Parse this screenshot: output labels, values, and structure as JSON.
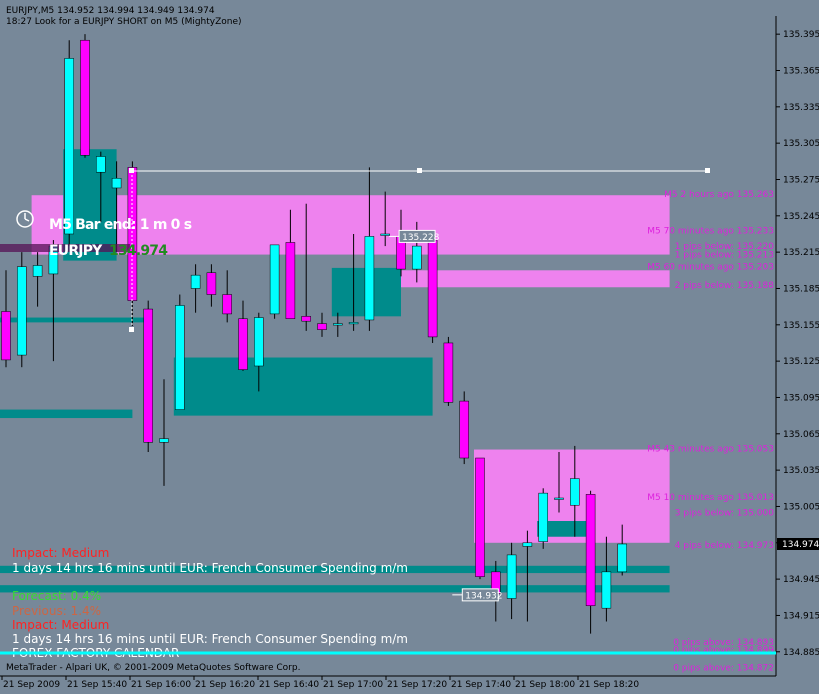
{
  "header": {
    "symbol_line": "EURJPY,M5  134.952 134.994 134.949 134.974",
    "comment_line": "18:27 Look for a EURJPY SHORT on M5 (MightyZone)"
  },
  "overlay": {
    "bar_end": "M5 Bar end: 1 m 0 s",
    "symbol": "EURJPY",
    "price": "134.974"
  },
  "footer": {
    "copyright": "MetaTrader - Alpari UK, © 2001-2009 MetaQuotes Software Corp."
  },
  "news": {
    "impact1": "Impact: Medium",
    "event1": "1 days 14 hrs 16 mins until EUR: French Consumer Spending m/m",
    "forecast": "Forecast: 0.4%",
    "previous": "Previous: 1.4%",
    "impact2": "Impact: Medium",
    "event2": "1 days 14 hrs 16 mins until EUR: French Consumer Spending m/m",
    "calendar": "FOREX FACTORY CALENDAR"
  },
  "colors": {
    "background": "#778899",
    "bull": "#00FFFF",
    "bear": "#FF00FF",
    "zone_teal": "#008B8B",
    "zone_pink": "#EE82EE",
    "zone_label": "#DD22DD"
  },
  "chart_data": {
    "type": "candlestick",
    "ylim": [
      134.865,
      135.41
    ],
    "y_ticks": [
      "135.395",
      "135.365",
      "135.335",
      "135.305",
      "135.275",
      "135.245",
      "135.215",
      "135.185",
      "135.155",
      "135.125",
      "135.095",
      "135.065",
      "135.035",
      "135.005",
      "134.975",
      "134.945",
      "134.915",
      "134.885"
    ],
    "current_price": "134.974",
    "x_labels": [
      "21 Sep 2009",
      "21 Sep 15:40",
      "21 Sep 16:00",
      "21 Sep 16:20",
      "21 Sep 16:40",
      "21 Sep 17:00",
      "21 Sep 17:20",
      "21 Sep 17:40",
      "21 Sep 18:00",
      "21 Sep 18:20"
    ],
    "candles": [
      {
        "o": 135.166,
        "h": 135.2,
        "l": 135.12,
        "c": 135.126
      },
      {
        "o": 135.13,
        "h": 135.215,
        "l": 135.12,
        "c": 135.203
      },
      {
        "o": 135.195,
        "h": 135.215,
        "l": 135.17,
        "c": 135.204
      },
      {
        "o": 135.197,
        "h": 135.225,
        "l": 135.125,
        "c": 135.22
      },
      {
        "o": 135.23,
        "h": 135.39,
        "l": 135.22,
        "c": 135.375
      },
      {
        "o": 135.39,
        "h": 135.395,
        "l": 135.293,
        "c": 135.295
      },
      {
        "o": 135.281,
        "h": 135.298,
        "l": 135.24,
        "c": 135.294
      },
      {
        "o": 135.268,
        "h": 135.29,
        "l": 135.215,
        "c": 135.276
      },
      {
        "o": 135.285,
        "h": 135.29,
        "l": 135.154,
        "c": 135.175
      },
      {
        "o": 135.168,
        "h": 135.175,
        "l": 135.05,
        "c": 135.058
      },
      {
        "o": 135.058,
        "h": 135.11,
        "l": 135.022,
        "c": 135.061
      },
      {
        "o": 135.085,
        "h": 135.18,
        "l": 135.085,
        "c": 135.171
      },
      {
        "o": 135.185,
        "h": 135.205,
        "l": 135.165,
        "c": 135.196
      },
      {
        "o": 135.198,
        "h": 135.205,
        "l": 135.17,
        "c": 135.18
      },
      {
        "o": 135.18,
        "h": 135.2,
        "l": 135.157,
        "c": 135.164
      },
      {
        "o": 135.16,
        "h": 135.175,
        "l": 135.117,
        "c": 135.118
      },
      {
        "o": 135.121,
        "h": 135.165,
        "l": 135.1,
        "c": 135.161
      },
      {
        "o": 135.164,
        "h": 135.218,
        "l": 135.16,
        "c": 135.221
      },
      {
        "o": 135.223,
        "h": 135.25,
        "l": 135.16,
        "c": 135.16
      },
      {
        "o": 135.162,
        "h": 135.255,
        "l": 135.15,
        "c": 135.158
      },
      {
        "o": 135.156,
        "h": 135.165,
        "l": 135.145,
        "c": 135.151
      },
      {
        "o": 135.156,
        "h": 135.165,
        "l": 135.145,
        "c": 135.156
      },
      {
        "o": 135.156,
        "h": 135.23,
        "l": 135.15,
        "c": 135.157
      },
      {
        "o": 135.159,
        "h": 135.285,
        "l": 135.15,
        "c": 135.228
      },
      {
        "o": 135.229,
        "h": 135.265,
        "l": 135.22,
        "c": 135.23
      },
      {
        "o": 135.228,
        "h": 135.25,
        "l": 135.195,
        "c": 135.201
      },
      {
        "o": 135.201,
        "h": 135.24,
        "l": 135.19,
        "c": 135.22
      },
      {
        "o": 135.225,
        "h": 135.23,
        "l": 135.14,
        "c": 135.145
      },
      {
        "o": 135.14,
        "h": 135.145,
        "l": 135.088,
        "c": 135.091
      },
      {
        "o": 135.092,
        "h": 135.1,
        "l": 135.04,
        "c": 135.045
      },
      {
        "o": 135.045,
        "h": 135.045,
        "l": 134.945,
        "c": 134.947
      },
      {
        "o": 134.951,
        "h": 134.96,
        "l": 134.91,
        "c": 134.933
      },
      {
        "o": 134.929,
        "h": 134.975,
        "l": 134.912,
        "c": 134.965
      },
      {
        "o": 134.972,
        "h": 134.985,
        "l": 134.91,
        "c": 134.975
      },
      {
        "o": 134.976,
        "h": 135.02,
        "l": 134.97,
        "c": 135.016
      },
      {
        "o": 135.012,
        "h": 135.05,
        "l": 135.0,
        "c": 135.012
      },
      {
        "o": 135.006,
        "h": 135.055,
        "l": 134.98,
        "c": 135.028
      },
      {
        "o": 135.015,
        "h": 135.018,
        "l": 134.9,
        "c": 134.923
      },
      {
        "o": 134.921,
        "h": 134.98,
        "l": 134.91,
        "c": 134.951
      },
      {
        "o": 134.951,
        "h": 134.99,
        "l": 134.948,
        "c": 134.974
      }
    ],
    "zones": [
      {
        "from_bar": 2,
        "to_bar": 42,
        "top": 135.262,
        "bottom": 135.213,
        "kind": "pink"
      },
      {
        "from_bar": 24,
        "to_bar": 42,
        "top": 135.2,
        "bottom": 135.186,
        "kind": "pink"
      },
      {
        "from_bar": 30,
        "to_bar": 42,
        "top": 135.052,
        "bottom": 134.975,
        "kind": "pink"
      },
      {
        "from_bar": 4,
        "to_bar": 7,
        "top": 135.3,
        "bottom": 135.208,
        "kind": "teal"
      },
      {
        "from_bar": 0,
        "to_bar": 9,
        "top": 135.161,
        "bottom": 135.157,
        "kind": "teal"
      },
      {
        "from_bar": 0,
        "to_bar": 8,
        "top": 135.085,
        "bottom": 135.078,
        "kind": "teal"
      },
      {
        "from_bar": 11,
        "to_bar": 27,
        "top": 135.128,
        "bottom": 135.08,
        "kind": "teal"
      },
      {
        "from_bar": 21,
        "to_bar": 25,
        "top": 135.202,
        "bottom": 135.162,
        "kind": "teal"
      },
      {
        "from_bar": 34,
        "to_bar": 37,
        "top": 134.993,
        "bottom": 134.98,
        "kind": "teal"
      },
      {
        "from_bar": 0,
        "to_bar": 42,
        "top": 134.956,
        "bottom": 134.95,
        "kind": "teal"
      },
      {
        "from_bar": 0,
        "to_bar": 42,
        "top": 134.94,
        "bottom": 134.934,
        "kind": "teal"
      }
    ],
    "zone_labels": [
      {
        "text": "M5 2 hours ago 135.263",
        "y": 135.263
      },
      {
        "text": "M5 70 minutes ago 135.233",
        "y": 135.233
      },
      {
        "text": "1 pips below: 135.220",
        "y": 135.22
      },
      {
        "text": "1 pips below: 135.213",
        "y": 135.213
      },
      {
        "text": "M5 60 minutes ago 135.203",
        "y": 135.203
      },
      {
        "text": "2 pips below: 135.188",
        "y": 135.188
      },
      {
        "text": "M5 43 minutes ago 135.053",
        "y": 135.053
      },
      {
        "text": "M5 10 minutes ago 135.013",
        "y": 135.013
      },
      {
        "text": "3 pips below: 135.000",
        "y": 135.0
      },
      {
        "text": "4 pips below: 134.973",
        "y": 134.973
      },
      {
        "text": "0 pips above: 134.893",
        "y": 134.893
      },
      {
        "text": "0 pips above: 134.899",
        "y": 134.887
      },
      {
        "text": "0 pips above: 134.872",
        "y": 134.872
      }
    ],
    "price_tags": [
      {
        "text": "135.228",
        "y": 135.228,
        "bar": 24.5
      },
      {
        "text": "134.932",
        "y": 134.932,
        "bar": 28.5
      }
    ]
  }
}
